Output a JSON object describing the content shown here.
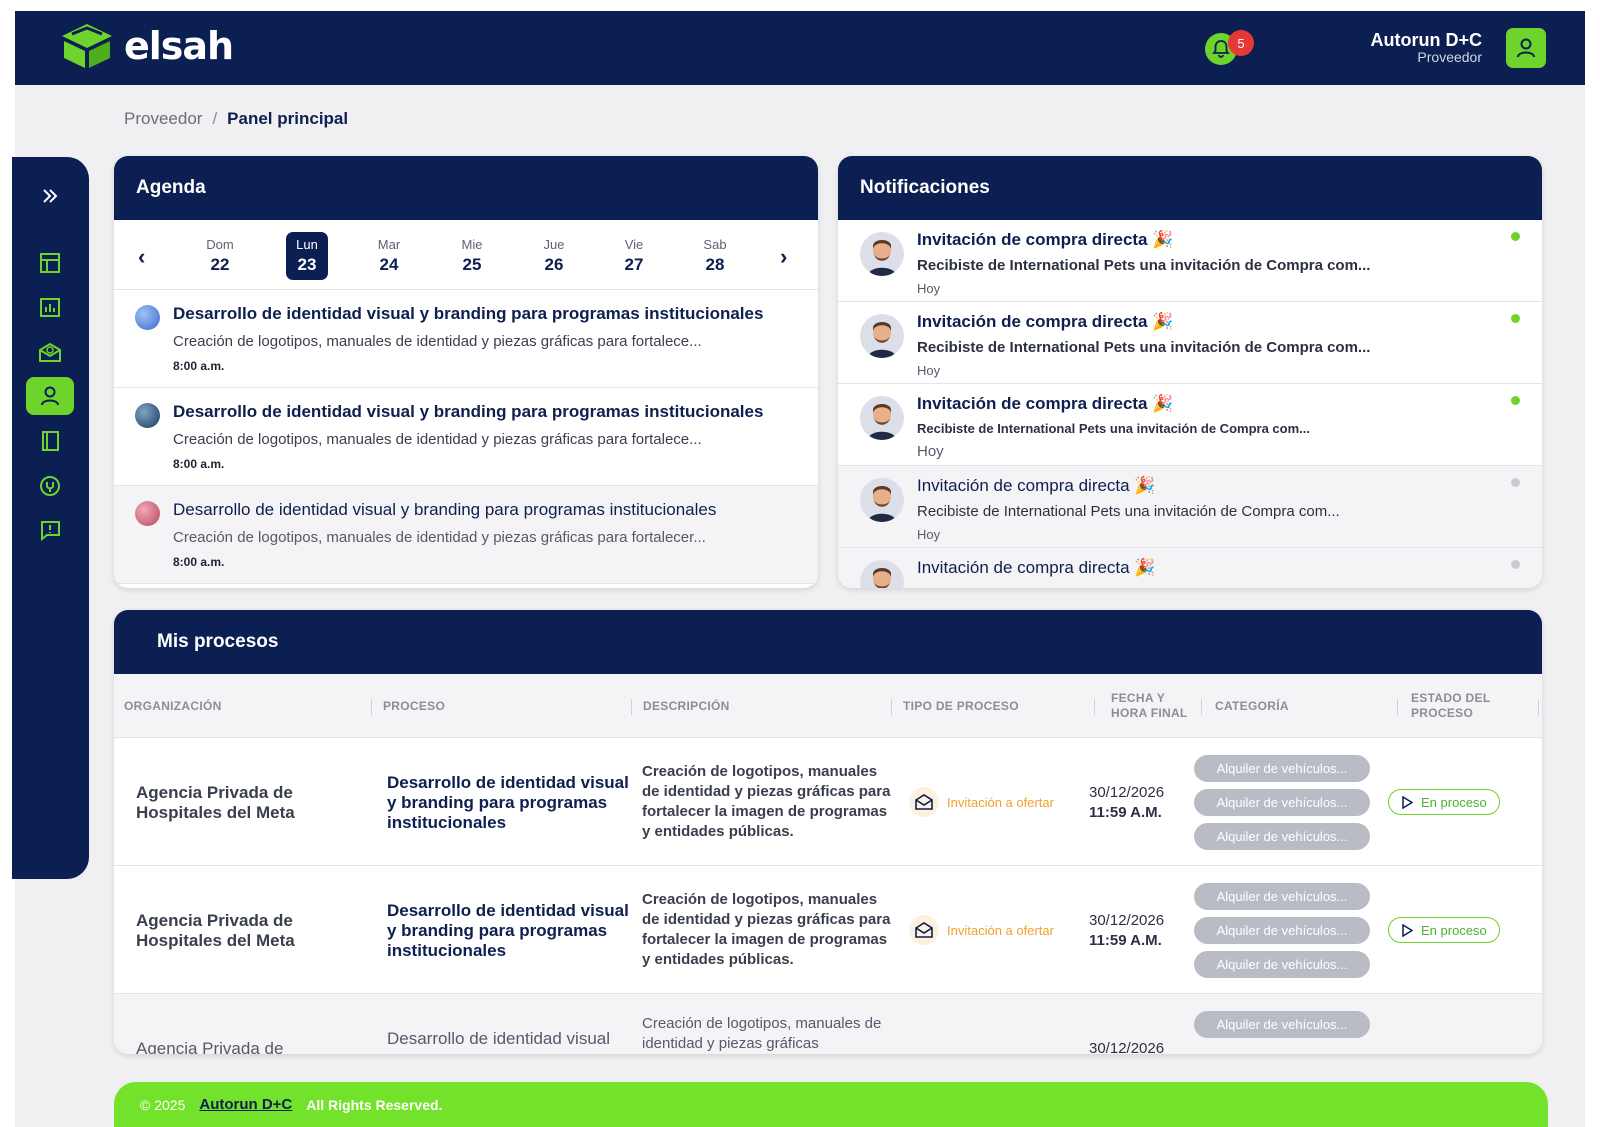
{
  "header": {
    "brand": "elsah",
    "notification_count": "5",
    "user_name": "Autorun D+C",
    "user_role": "Proveedor"
  },
  "breadcrumb": {
    "root": "Proveedor",
    "separator": "/",
    "current": "Panel principal"
  },
  "sidebar": {
    "items": [
      {
        "icon": "expand-icon"
      },
      {
        "icon": "layout-icon"
      },
      {
        "icon": "chart-icon"
      },
      {
        "icon": "mail-badge-icon"
      },
      {
        "icon": "user-icon",
        "active": true
      },
      {
        "icon": "notebook-icon"
      },
      {
        "icon": "support-icon"
      },
      {
        "icon": "feedback-icon"
      }
    ]
  },
  "agenda": {
    "title": "Agenda",
    "days": [
      {
        "name": "Dom",
        "num": "22"
      },
      {
        "name": "Lun",
        "num": "23",
        "selected": true
      },
      {
        "name": "Mar",
        "num": "24"
      },
      {
        "name": "Mie",
        "num": "25"
      },
      {
        "name": "Jue",
        "num": "26"
      },
      {
        "name": "Vie",
        "num": "27"
      },
      {
        "name": "Sab",
        "num": "28"
      }
    ],
    "items": [
      {
        "title": "Desarrollo de identidad visual y branding para programas institucionales",
        "desc": "Creación de logotipos, manuales de identidad y piezas gráficas para fortalece...",
        "time": "8:00 a.m."
      },
      {
        "title": "Desarrollo de identidad visual y branding para programas institucionales",
        "desc": "Creación de logotipos, manuales de identidad y piezas gráficas para fortalece...",
        "time": "8:00 a.m."
      },
      {
        "title": "Desarrollo de identidad visual y branding para programas institucionales",
        "desc": "Creación de logotipos, manuales de identidad y piezas gráficas para fortalecer...",
        "time": "8:00 a.m."
      }
    ]
  },
  "notifications": {
    "title": "Notificaciones",
    "items": [
      {
        "title": "Invitación de compra directa 🎉",
        "desc": "Recibiste de International Pets una invitación de Compra com...",
        "when": "Hoy",
        "unread": true
      },
      {
        "title": "Invitación de compra directa 🎉",
        "desc": "Recibiste de International Pets una invitación de Compra com...",
        "when": "Hoy",
        "unread": true
      },
      {
        "title": "Invitación de compra directa 🎉",
        "desc": "Recibiste de International Pets una invitación de Compra com...",
        "when": "Hoy",
        "unread": true
      },
      {
        "title": "Invitación de compra directa 🎉",
        "desc": "Recibiste de International Pets una invitación de Compra com...",
        "when": "Hoy",
        "unread": false
      },
      {
        "title": "Invitación de compra directa 🎉",
        "desc": "",
        "when": "",
        "unread": false
      }
    ]
  },
  "procesos": {
    "title": "Mis procesos",
    "columns": [
      "ORGANIZACIÓN",
      "PROCESO",
      "DESCRIPCIÓN",
      "TIPO DE PROCESO",
      "FECHA Y HORA FINAL",
      "CATEGORÍA",
      "ESTADO DEL PROCESO"
    ],
    "rows": [
      {
        "org": "Agencia Privada de Hospitales del Meta",
        "proc": "Desarrollo de identidad visual y branding para programas institucionales",
        "desc": "Creación de logotipos, manuales de identidad y piezas gráficas para fortalecer la imagen de programas y entidades públicas.",
        "tipo": "Invitación a ofertar",
        "fecha": "30/12/2026",
        "hora": "11:59 A.M.",
        "cats": [
          "Alquiler de vehículos...",
          "Alquiler de vehículos...",
          "Alquiler de vehículos..."
        ],
        "estado": "En proceso"
      },
      {
        "org": "Agencia Privada de Hospitales del Meta",
        "proc": "Desarrollo de identidad visual y branding para programas institucionales",
        "desc": "Creación de logotipos, manuales de identidad y piezas gráficas para fortalecer la imagen de programas y entidades públicas.",
        "tipo": "Invitación a ofertar",
        "fecha": "30/12/2026",
        "hora": "11:59 A.M.",
        "cats": [
          "Alquiler de vehículos...",
          "Alquiler de vehículos...",
          "Alquiler de vehículos..."
        ],
        "estado": "En proceso"
      },
      {
        "org": "Agencia Privada de",
        "proc": "Desarrollo de identidad visual",
        "desc": "Creación de logotipos, manuales de identidad y piezas gráficas",
        "tipo": "",
        "fecha": "30/12/2026",
        "hora": "",
        "cats": [
          "Alquiler de vehículos..."
        ],
        "estado": ""
      }
    ]
  },
  "footer": {
    "copyright": "© 2025",
    "link": "Autorun D+C",
    "rights": "All Rights Reserved."
  },
  "colors": {
    "navy": "#0b1f52",
    "green": "#6ed32a",
    "orange": "#f0a32a",
    "badge_red": "#e53935"
  }
}
